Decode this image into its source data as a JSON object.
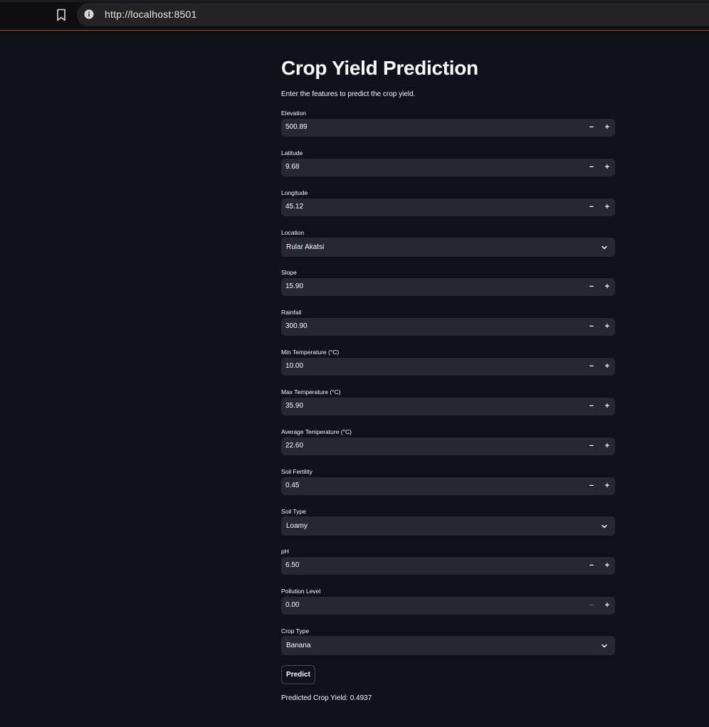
{
  "browser": {
    "url": "http://localhost:8501"
  },
  "page": {
    "title": "Crop Yield Prediction",
    "subtitle": "Enter the features to predict the crop yield."
  },
  "fields": {
    "elevation": {
      "label": "Elevation",
      "value": "500.89"
    },
    "latitude": {
      "label": "Latitude",
      "value": "9.68"
    },
    "longitude": {
      "label": "Longitude",
      "value": "45.12"
    },
    "location": {
      "label": "Location",
      "value": "Rular Akatsi"
    },
    "slope": {
      "label": "Slope",
      "value": "15.90"
    },
    "rainfall": {
      "label": "Rainfall",
      "value": "300.90"
    },
    "min_temp": {
      "label": "Min Temperature (°C)",
      "value": "10.00"
    },
    "max_temp": {
      "label": "Max Temperature (°C)",
      "value": "35.90"
    },
    "avg_temp": {
      "label": "Average Temperature (°C)",
      "value": "22.60"
    },
    "soil_fertility": {
      "label": "Soil Fertility",
      "value": "0.45"
    },
    "soil_type": {
      "label": "Soil Type",
      "value": "Loamy"
    },
    "ph": {
      "label": "pH",
      "value": "6.50"
    },
    "pollution": {
      "label": "Pollution Level",
      "value": "0.00"
    },
    "crop_type": {
      "label": "Crop Type",
      "value": "Banana"
    }
  },
  "stepper": {
    "minus": "−",
    "plus": "+"
  },
  "actions": {
    "predict_label": "Predict"
  },
  "result": {
    "text": "Predicted Crop Yield: 0.4937"
  },
  "colors": {
    "background": "#0e1117",
    "input_bg": "#262730",
    "text": "#fafafa",
    "accent_line": "#c0392b"
  },
  "icons": {
    "bookmark": "bookmark-icon",
    "info": "info-icon",
    "dropdown": "chevron-down-icon"
  }
}
